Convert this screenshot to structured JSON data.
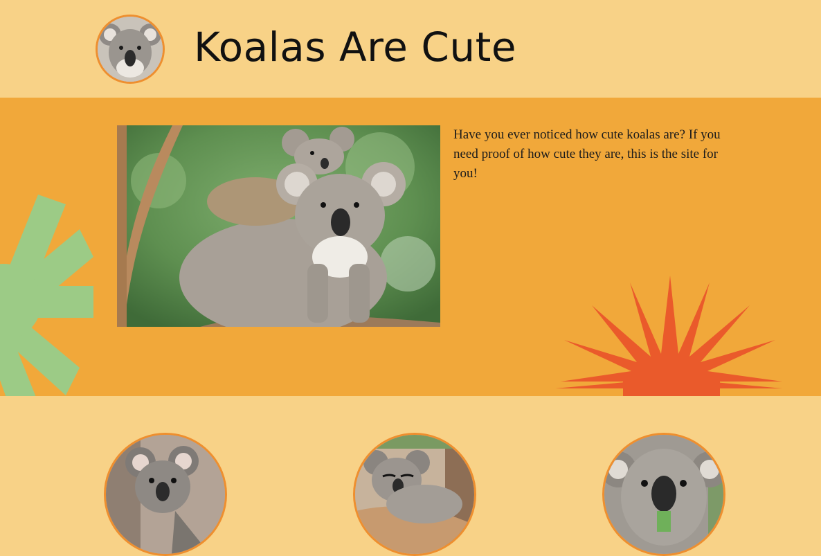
{
  "site": {
    "title": "Koalas Are Cute"
  },
  "intro": {
    "text": "Have you ever noticed how cute koalas are? If you need proof of how cute they are, this is the site for you!"
  },
  "colors": {
    "header_bg": "#f8d287",
    "hero_bg": "#f1a83a",
    "accent_border": "#ee8f2f",
    "asterisk": "#9ccb86",
    "starburst": "#ea5a2b"
  },
  "icons": {
    "logo": "koala-face-icon",
    "decorations": [
      "asterisk-shape",
      "starburst-shape"
    ]
  },
  "gallery": {
    "items": [
      "koala-photo",
      "koala-photo",
      "koala-photo"
    ]
  }
}
